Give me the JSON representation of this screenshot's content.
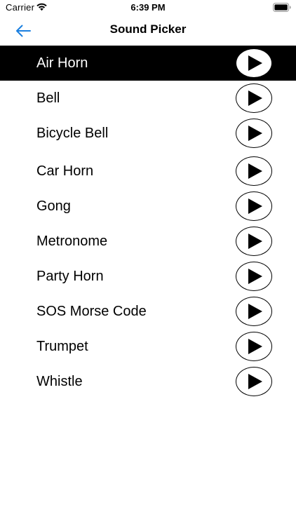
{
  "status_bar": {
    "carrier": "Carrier",
    "time": "6:39 PM",
    "wifi_icon": "wifi-icon",
    "battery_icon": "battery-icon"
  },
  "nav": {
    "title": "Sound Picker",
    "back_icon": "arrow-left-icon"
  },
  "colors": {
    "accent": "#1a7fe0",
    "selected_row_bg": "#000000",
    "selected_row_text": "#ffffff"
  },
  "sounds": [
    {
      "label": "Air Horn",
      "selected": true,
      "icon": "play-icon"
    },
    {
      "label": "Bell",
      "selected": false,
      "icon": "play-icon"
    },
    {
      "label": "Bicycle Bell",
      "selected": false,
      "icon": "play-icon"
    },
    {
      "label": "Car Horn",
      "selected": false,
      "icon": "play-icon"
    },
    {
      "label": "Gong",
      "selected": false,
      "icon": "play-icon"
    },
    {
      "label": "Metronome",
      "selected": false,
      "icon": "play-icon"
    },
    {
      "label": "Party Horn",
      "selected": false,
      "icon": "play-icon"
    },
    {
      "label": "SOS Morse Code",
      "selected": false,
      "icon": "play-icon"
    },
    {
      "label": "Trumpet",
      "selected": false,
      "icon": "play-icon"
    },
    {
      "label": "Whistle",
      "selected": false,
      "icon": "play-icon"
    }
  ]
}
